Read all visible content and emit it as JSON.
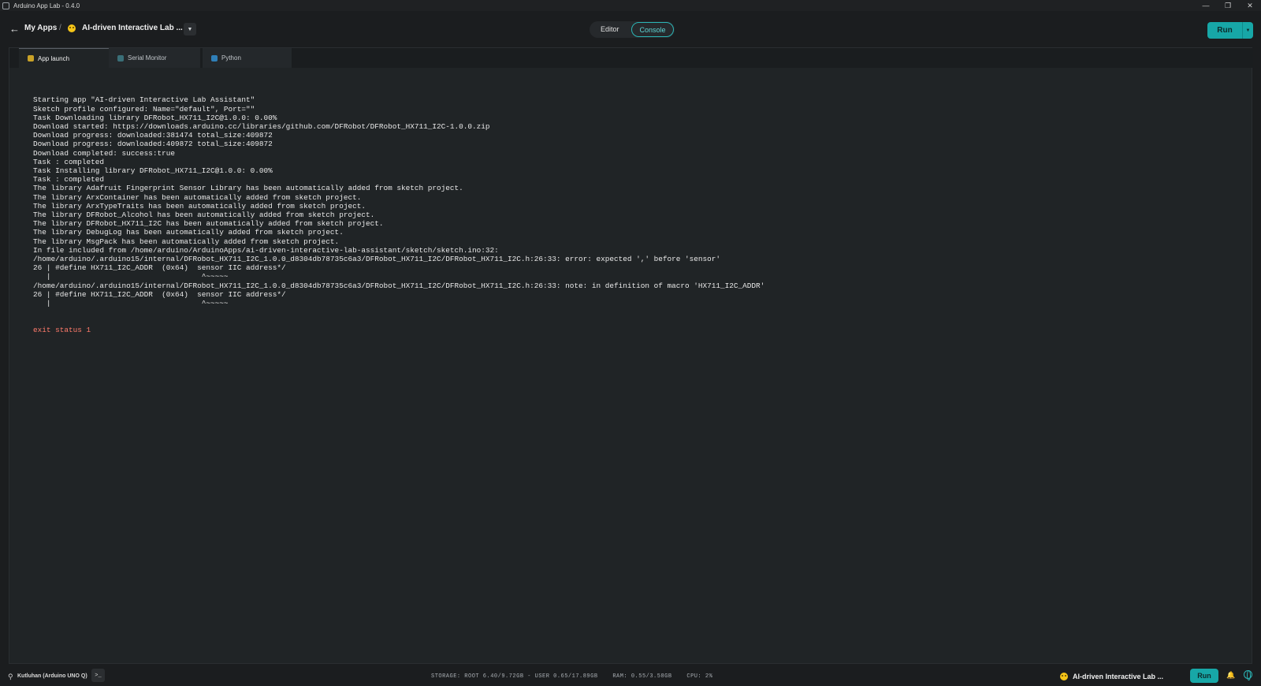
{
  "window": {
    "title": "Arduino App Lab - 0.4.0",
    "controls": {
      "minimize": "—",
      "maximize": "❐",
      "close": "✕"
    }
  },
  "header": {
    "back_icon": "←",
    "breadcrumb_root": "My Apps",
    "breadcrumb_separator": "/",
    "app_name": "AI-driven Interactive Lab ...",
    "dropdown_icon": "▼",
    "mode_editor": "Editor",
    "mode_console": "Console",
    "run_label": "Run",
    "run_menu_icon": "▼"
  },
  "tabs": [
    {
      "label": "App launch",
      "icon_color": "#c9a227"
    },
    {
      "label": "Serial Monitor",
      "icon_color": "#3a6f78"
    },
    {
      "label": "Python",
      "icon_color": "#2f7fb8"
    }
  ],
  "console": {
    "lines": [
      "Starting app \"AI-driven Interactive Lab Assistant\"",
      "Sketch profile configured: Name=\"default\", Port=\"\"",
      "Task Downloading library DFRobot_HX711_I2C@1.0.0: 0.00%",
      "Download started: https://downloads.arduino.cc/libraries/github.com/DFRobot/DFRobot_HX711_I2C-1.0.0.zip",
      "Download progress: downloaded:381474 total_size:409872",
      "Download progress: downloaded:409872 total_size:409872",
      "Download completed: success:true",
      "Task : completed",
      "Task Installing library DFRobot_HX711_I2C@1.0.0: 0.00%",
      "Task : completed",
      "The library Adafruit Fingerprint Sensor Library has been automatically added from sketch project.",
      "The library ArxContainer has been automatically added from sketch project.",
      "The library ArxTypeTraits has been automatically added from sketch project.",
      "The library DFRobot_Alcohol has been automatically added from sketch project.",
      "The library DFRobot_HX711_I2C has been automatically added from sketch project.",
      "The library DebugLog has been automatically added from sketch project.",
      "The library MsgPack has been automatically added from sketch project.",
      "In file included from /home/arduino/ArduinoApps/ai-driven-interactive-lab-assistant/sketch/sketch.ino:32:",
      "/home/arduino/.arduino15/internal/DFRobot_HX711_I2C_1.0.0_d8304db78735c6a3/DFRobot_HX711_I2C/DFRobot_HX711_I2C.h:26:33: error: expected ',' before 'sensor'",
      "26 | #define HX711_I2C_ADDR  (0x64)  sensor IIC address*/",
      "   |                                  ^~~~~~",
      "/home/arduino/.arduino15/internal/DFRobot_HX711_I2C_1.0.0_d8304db78735c6a3/DFRobot_HX711_I2C/DFRobot_HX711_I2C.h:26:33: note: in definition of macro 'HX711_I2C_ADDR'",
      "26 | #define HX711_I2C_ADDR  (0x64)  sensor IIC address*/",
      "   |                                  ^~~~~~"
    ],
    "exit_line": "exit status 1"
  },
  "statusbar": {
    "usb_icon": "⚲",
    "board": "Kutluhan (Arduino UNO Q)",
    "terminal_icon": ">_",
    "storage": "STORAGE: ROOT 6.40/9.72GB - USER 0.65/17.89GB",
    "ram": "RAM: 0.55/3.58GB",
    "cpu": "CPU: 2%",
    "app_name": "AI-driven Interactive Lab ...",
    "run_label": "Run",
    "bell_icon": "🔔"
  }
}
